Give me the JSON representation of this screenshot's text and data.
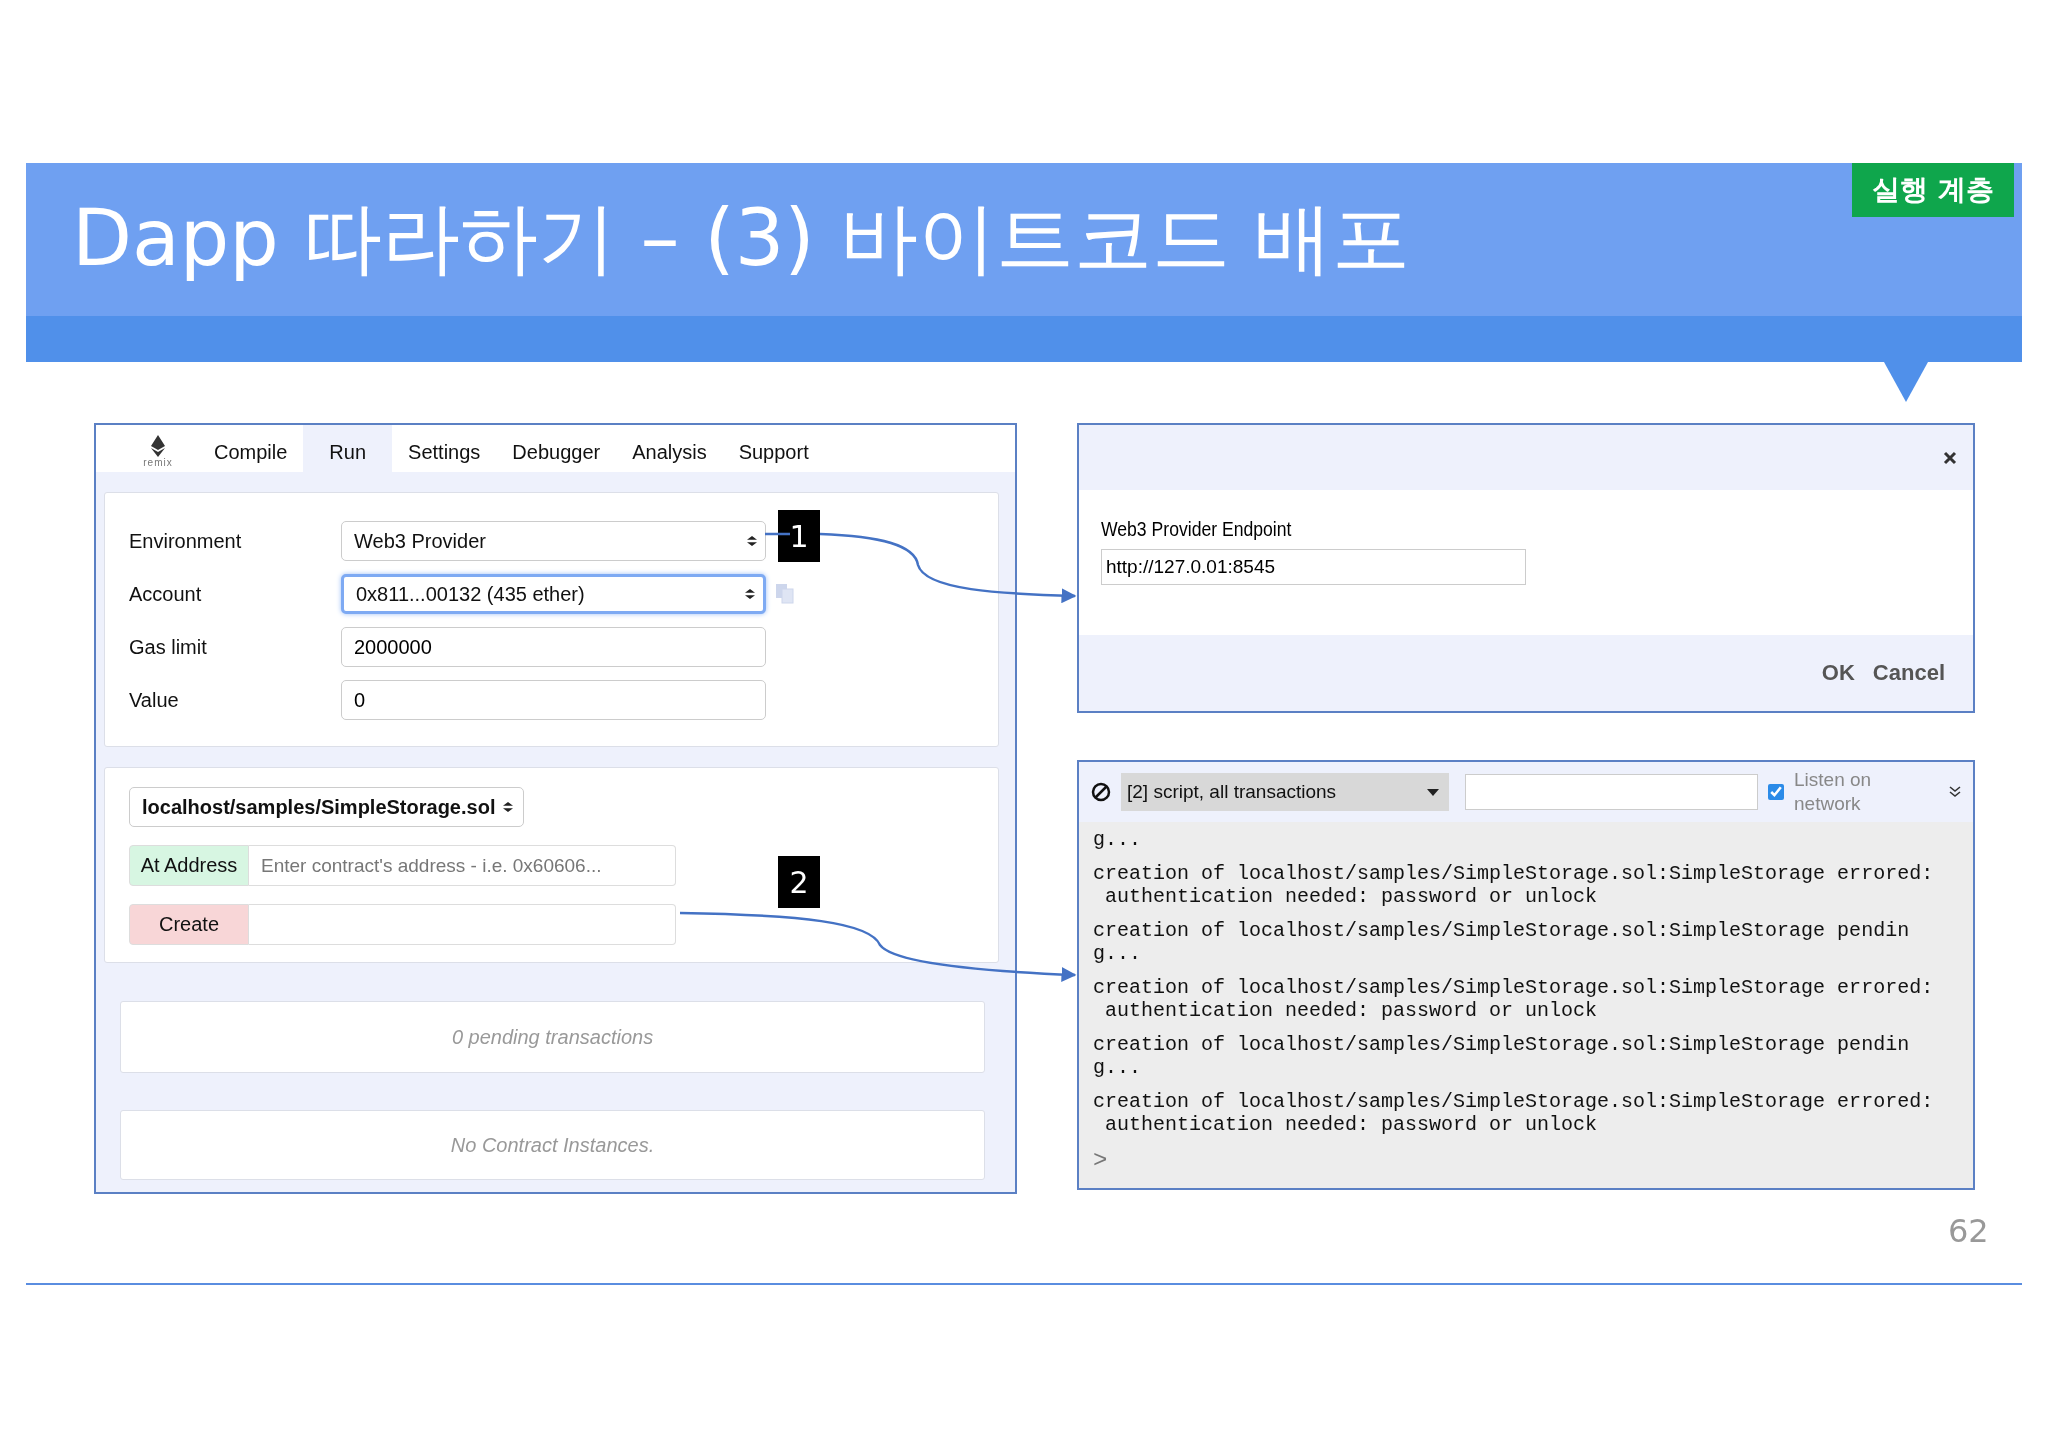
{
  "slide": {
    "title": "Dapp 따라하기 – (3) 바이트코드 배포",
    "badge": "실행 계층",
    "page_number": "62"
  },
  "callouts": [
    {
      "label": "1"
    },
    {
      "label": "2"
    }
  ],
  "remix": {
    "logo_text": "remix",
    "tabs": [
      {
        "label": "Compile",
        "selected": false
      },
      {
        "label": "Run",
        "selected": true
      },
      {
        "label": "Settings",
        "selected": false
      },
      {
        "label": "Debugger",
        "selected": false
      },
      {
        "label": "Analysis",
        "selected": false
      },
      {
        "label": "Support",
        "selected": false
      }
    ],
    "settings": [
      {
        "label": "Environment",
        "kind": "select",
        "value": "Web3 Provider",
        "focused": false
      },
      {
        "label": "Account",
        "kind": "select",
        "value": "0x811...00132 (435 ether)",
        "focused": true
      },
      {
        "label": "Gas limit",
        "kind": "input",
        "value": "2000000"
      },
      {
        "label": "Value",
        "kind": "input",
        "value": "0"
      }
    ],
    "contract_select": "localhost/samples/SimpleStorage.sol",
    "at_address": {
      "button": "At Address",
      "placeholder": "Enter contract's address - i.e. 0x60606..."
    },
    "create": {
      "button": "Create"
    },
    "pending": "0 pending transactions",
    "instances": "No Contract Instances."
  },
  "dialog": {
    "label": "Web3 Provider Endpoint",
    "value": "http://127.0.01:8545",
    "buttons": [
      "OK",
      "Cancel"
    ]
  },
  "console": {
    "filter_select": "[2] script, all transactions",
    "listen": {
      "label": "Listen on network",
      "checked": true
    },
    "log": [
      "g...",
      "creation of localhost/samples/SimpleStorage.sol:SimpleStorage errored:\n authentication needed: password or unlock",
      "creation of localhost/samples/SimpleStorage.sol:SimpleStorage pendin\ng...",
      "creation of localhost/samples/SimpleStorage.sol:SimpleStorage errored:\n authentication needed: password or unlock",
      "creation of localhost/samples/SimpleStorage.sol:SimpleStorage pendin\ng...",
      "creation of localhost/samples/SimpleStorage.sol:SimpleStorage errored:\n authentication needed: password or unlock"
    ],
    "prompt": ">"
  }
}
